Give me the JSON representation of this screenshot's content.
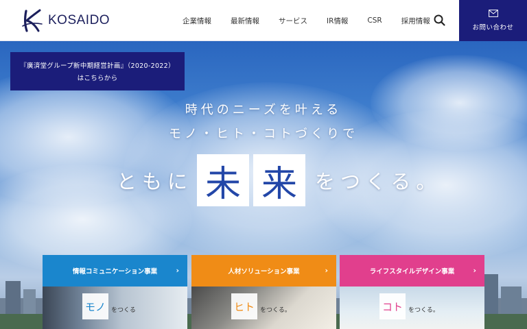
{
  "header": {
    "logo_text": "KOSAIDO",
    "nav": [
      "企業情報",
      "最新情報",
      "サービス",
      "IR情報",
      "CSR",
      "採用情報"
    ],
    "contact_label": "お問い合わせ"
  },
  "hero": {
    "plan_banner": {
      "line1": "『廣済堂グループ新中期経営計画』（2020-2022）",
      "line2": "はこちらから"
    },
    "copy_line1": "時代のニーズを叶える",
    "copy_line2": "モノ・ヒト・コトづくりで",
    "copy_line3_pre": "ともに",
    "copy_mirai": [
      "未",
      "来"
    ],
    "copy_line3_post": "をつくる。"
  },
  "cards": [
    {
      "title": "情報コミュニケーション事業",
      "word": "モノ",
      "sub": "をつくる",
      "color": "#1a86cd"
    },
    {
      "title": "人材ソリューション事業",
      "word": "ヒト",
      "sub": "をつくる。",
      "color": "#f08c16"
    },
    {
      "title": "ライフスタイルデザイン事業",
      "word": "コト",
      "sub": "をつくる。",
      "color": "#e13f8d"
    }
  ],
  "colors": {
    "brand_navy": "#1b1d7a",
    "mirai_blue": "#2347a8"
  },
  "icons": {
    "search": "search-icon",
    "mail": "mail-icon",
    "chevron": "chevron-right-icon"
  }
}
